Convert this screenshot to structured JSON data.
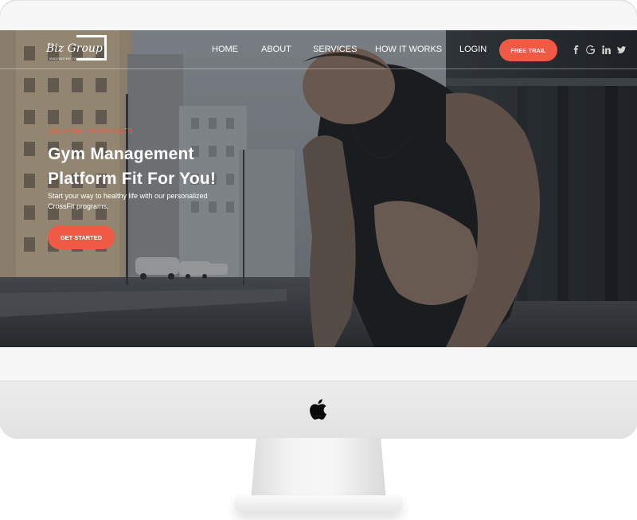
{
  "brand": {
    "name": "Biz Group",
    "tagline": "INNOVATING TOGETHER"
  },
  "nav": {
    "items": [
      {
        "label": "HOME"
      },
      {
        "label": "ABOUT"
      },
      {
        "label": "SERVICES"
      },
      {
        "label": "HOW IT WORKS"
      },
      {
        "label": "LOGIN"
      }
    ],
    "cta_label": "FREE TRAIL",
    "social_icons": [
      "facebook-icon",
      "google-icon",
      "linkedin-icon",
      "twitter-icon"
    ]
  },
  "hero": {
    "kicker": "CROSSFIT ELEMENTS",
    "headline_line1": "Gym Management",
    "headline_line2": "Platform Fit For You!",
    "subtext": "Start your way to healthy life with our personalized CrossFit programs.",
    "cta_label": "GET STARTED"
  },
  "colors": {
    "accent": "#f05a44",
    "nav_text": "#ffffff",
    "device_frame": "#f7f7f7"
  }
}
